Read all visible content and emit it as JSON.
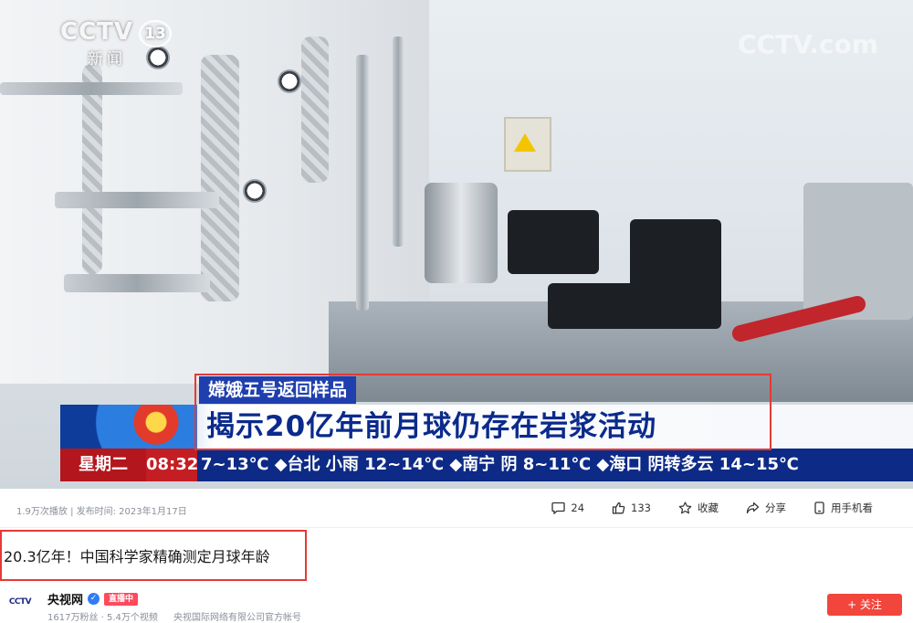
{
  "video": {
    "channel_logo": "CCTV",
    "channel_number": "13",
    "channel_name": "新闻",
    "watermark": "CCTV.com",
    "lower_third": {
      "tag": "嫦娥五号返回样品",
      "headline": "揭示20亿年前月球仍存在岩浆活动",
      "day": "星期二",
      "time": "08:32",
      "ticker": "7~13℃ ◆台北 小雨 12~14℃ ◆南宁 阴 8~11℃ ◆海口 阴转多云 14~15℃"
    }
  },
  "meta": {
    "views_date": "1.9万次播放 | 发布时间: 2023年1月17日",
    "actions": [
      {
        "icon": "comment-icon",
        "label": "24"
      },
      {
        "icon": "like-icon",
        "label": "133"
      },
      {
        "icon": "star-icon",
        "label": "收藏"
      },
      {
        "icon": "share-icon",
        "label": "分享"
      },
      {
        "icon": "phone-icon",
        "label": "用手机看"
      }
    ]
  },
  "title": "20.3亿年！中国科学家精确测定月球年龄",
  "channel": {
    "avatar_text": "CCTV",
    "name": "央视网",
    "live_badge": "直播中",
    "stats": "1617万粉丝 · 5.4万个视频",
    "description": "央视国际网络有限公司官方帐号",
    "follow_label": "+ 关注"
  },
  "colors": {
    "highlight": "#e53935",
    "follow": "#f2463d",
    "ticker_bg": "#0d2a86",
    "headline_text": "#0a2a8c"
  }
}
